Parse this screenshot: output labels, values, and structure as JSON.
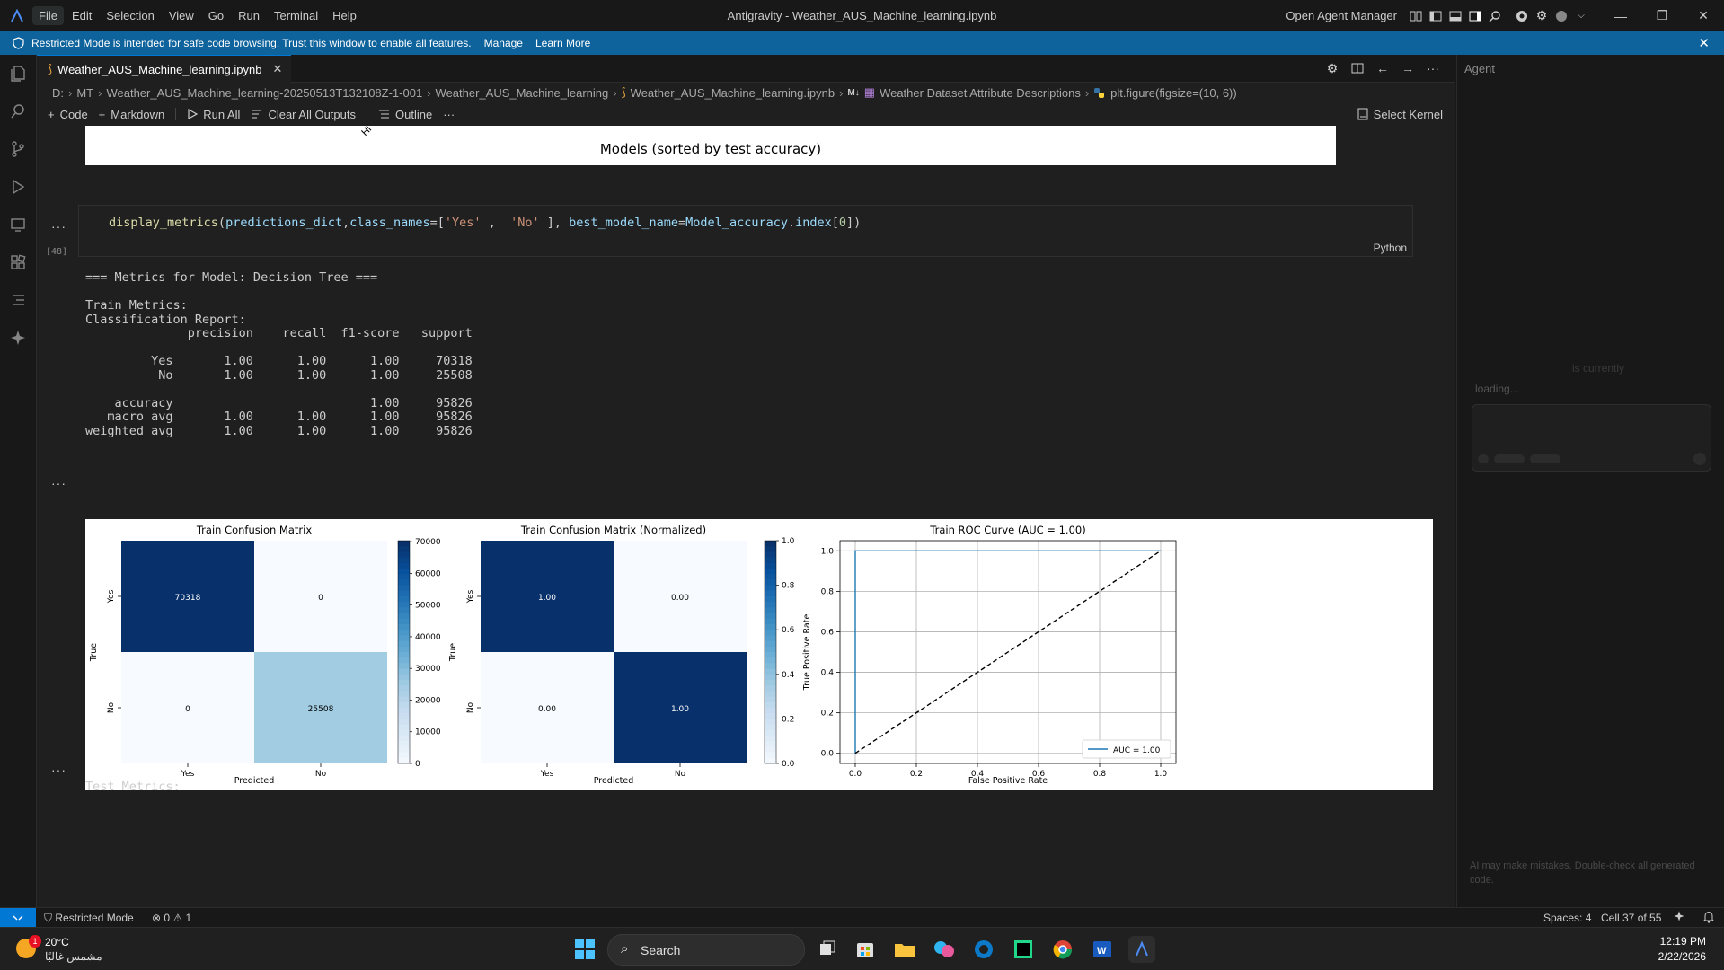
{
  "window": {
    "title": "Antigravity - Weather_AUS_Machine_learning.ipynb",
    "menu": [
      "File",
      "Edit",
      "Selection",
      "View",
      "Go",
      "Run",
      "Terminal",
      "Help"
    ],
    "open_agent_manager": "Open Agent Manager"
  },
  "banner": {
    "text": "Restricted Mode is intended for safe code browsing. Trust this window to enable all features.",
    "manage": "Manage",
    "learn_more": "Learn More"
  },
  "tab": {
    "label": "Weather_AUS_Machine_learning.ipynb"
  },
  "breadcrumb": [
    "D:",
    "MT",
    "Weather_AUS_Machine_learning-20250513T132108Z-1-001",
    "Weather_AUS_Machine_learning",
    "Weather_AUS_Machine_learning.ipynb",
    "Weather Dataset Attribute Descriptions",
    "plt.figure(figsize=(10, 6))"
  ],
  "breadcrumb_md_tag": "M↓",
  "toolbar": {
    "code": "Code",
    "markdown": "Markdown",
    "run_all": "Run All",
    "clear_all": "Clear All Outputs",
    "outline": "Outline",
    "more": "···",
    "select_kernel": "Select Kernel"
  },
  "prev_output": {
    "xlabel": "Models (sorted by test accuracy)",
    "tick_fragment": "Hi"
  },
  "cell": {
    "exec_count": "[48]",
    "language": "Python",
    "code_tokens": [
      {
        "t": "display_metrics",
        "c": "fn"
      },
      {
        "t": "(",
        "c": ""
      },
      {
        "t": "predictions_dict",
        "c": "var"
      },
      {
        "t": ",",
        "c": ""
      },
      {
        "t": "class_names",
        "c": "var"
      },
      {
        "t": "=[",
        "c": ""
      },
      {
        "t": "'Yes'",
        "c": "str"
      },
      {
        "t": " ,  ",
        "c": ""
      },
      {
        "t": "'No'",
        "c": "str"
      },
      {
        "t": " ], ",
        "c": ""
      },
      {
        "t": "best_model_name",
        "c": "var"
      },
      {
        "t": "=",
        "c": ""
      },
      {
        "t": "Model_accuracy",
        "c": "var"
      },
      {
        "t": ".",
        "c": ""
      },
      {
        "t": "index",
        "c": "var"
      },
      {
        "t": "[",
        "c": ""
      },
      {
        "t": "0",
        "c": "num"
      },
      {
        "t": "])",
        "c": ""
      }
    ]
  },
  "output_dots": "···",
  "output_text": [
    "=== Metrics for Model: Decision Tree ===",
    "",
    "Train Metrics:",
    "Classification Report:",
    "              precision    recall  f1-score   support",
    "",
    "         Yes       1.00      1.00      1.00     70318",
    "          No       1.00      1.00      1.00     25508",
    "",
    "    accuracy                           1.00     95826",
    "   macro avg       1.00      1.00      1.00     95826",
    "weighted avg       1.00      1.00      1.00     95826"
  ],
  "test_metrics_text": "Test Metrics:",
  "chart_data": [
    {
      "type": "heatmap",
      "title": "Train Confusion Matrix",
      "xlabel": "Predicted",
      "ylabel": "True",
      "x_categories": [
        "Yes",
        "No"
      ],
      "y_categories": [
        "Yes",
        "No"
      ],
      "values": [
        [
          70318,
          0
        ],
        [
          0,
          25508
        ]
      ],
      "cell_labels": [
        [
          "70318",
          "0"
        ],
        [
          "0",
          "25508"
        ]
      ],
      "colormap": "Blues",
      "colorbar_range": [
        0,
        70318
      ],
      "colorbar_ticks": [
        0,
        10000,
        20000,
        30000,
        40000,
        50000,
        60000,
        70000
      ]
    },
    {
      "type": "heatmap",
      "title": "Train Confusion Matrix (Normalized)",
      "xlabel": "Predicted",
      "ylabel": "True",
      "x_categories": [
        "Yes",
        "No"
      ],
      "y_categories": [
        "Yes",
        "No"
      ],
      "values": [
        [
          1.0,
          0.0
        ],
        [
          0.0,
          1.0
        ]
      ],
      "cell_labels": [
        [
          "1.00",
          "0.00"
        ],
        [
          "0.00",
          "1.00"
        ]
      ],
      "colormap": "Blues",
      "colorbar_range": [
        0,
        1
      ],
      "colorbar_ticks": [
        "0.0",
        "0.2",
        "0.4",
        "0.6",
        "0.8",
        "1.0"
      ]
    },
    {
      "type": "line",
      "title": "Train ROC Curve (AUC = 1.00)",
      "xlabel": "False Positive Rate",
      "ylabel": "True Positive Rate",
      "xlim": [
        -0.05,
        1.05
      ],
      "ylim": [
        -0.05,
        1.05
      ],
      "x_ticks": [
        "0.0",
        "0.2",
        "0.4",
        "0.6",
        "0.8",
        "1.0"
      ],
      "y_ticks": [
        "0.0",
        "0.2",
        "0.4",
        "0.6",
        "0.8",
        "1.0"
      ],
      "grid": true,
      "legend": "bottom-right",
      "series": [
        {
          "name": "AUC = 1.00",
          "color": "#1f77b4",
          "style": "solid",
          "x": [
            0,
            0,
            1
          ],
          "y": [
            0,
            1,
            1
          ]
        },
        {
          "color": "#000000",
          "style": "dashed",
          "x": [
            0,
            1
          ],
          "y": [
            0,
            1
          ]
        }
      ]
    }
  ],
  "agent": {
    "title": "Agent",
    "dim_text": "is currently",
    "loading": "loading...",
    "disclaimer": "AI may make mistakes. Double-check all generated code."
  },
  "statusbar": {
    "restricted": "Restricted Mode",
    "errors": "0",
    "warnings": "1",
    "spaces": "Spaces: 4",
    "cell": "Cell 37 of 55"
  },
  "taskbar": {
    "temp": "20°C",
    "condition": "مشمس غالبًا",
    "badge": "1",
    "search": "Search",
    "time": "12:19 PM",
    "date": "2/22/2026"
  },
  "colors": {
    "accent": "#0078d4",
    "banner": "#0e639c",
    "editor_bg": "#1f1f1f"
  }
}
